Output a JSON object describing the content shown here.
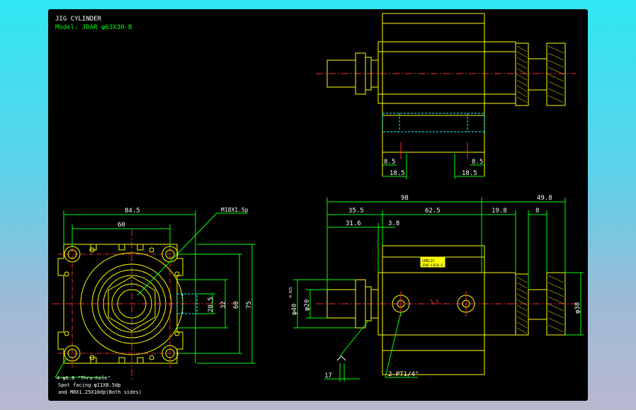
{
  "colors": {
    "background_gradient_top": "#2fe6f2",
    "background_gradient_bottom": "#b9b9cf",
    "canvas": "#000000",
    "outline": "#ffff00",
    "dimension": "#00ff00",
    "centerline": "#ff2a2a",
    "hidden": "#00ffff",
    "text_white": "#ffffff"
  },
  "title": {
    "line1": "JIG CYLINDER",
    "line2": "Model: JDAR φ63X30-B"
  },
  "dimensions": {
    "top_view": {
      "left_8_5": "8.5",
      "left_18_5": "18.5",
      "right_8_5": "8.5",
      "right_18_5": "18.5"
    },
    "front_view": {
      "overall_98": "98",
      "rod_49_8": "49.8",
      "d_35_5": "35.5",
      "d_62_5": "62.5",
      "d_19_8": "19.8",
      "d_8": "8",
      "d_31_6": "31.6",
      "d_3_8": "3.8",
      "phi40": "φ40",
      "phi40_tol": "-0.025",
      "phi20": "φ20",
      "phi38": "φ38",
      "d_17": "17",
      "port_note": "2-PT1/4\"",
      "label_tag_line1": "CHELIC",
      "label_tag_line2": "JDAR 63X30-B"
    },
    "side_view": {
      "d_84_5": "84.5",
      "d_60": "60",
      "d_20_5": "20.5",
      "d_32": "32",
      "d_60v": "60",
      "d_75": "75",
      "thread_note": "M18X1.5p",
      "note1": "4-φ6.8 \"Thru-hole\"",
      "note2": "Spot facing φ11X8.5dp",
      "note3": "and M8X1.25X10dp(Both sides)"
    }
  }
}
